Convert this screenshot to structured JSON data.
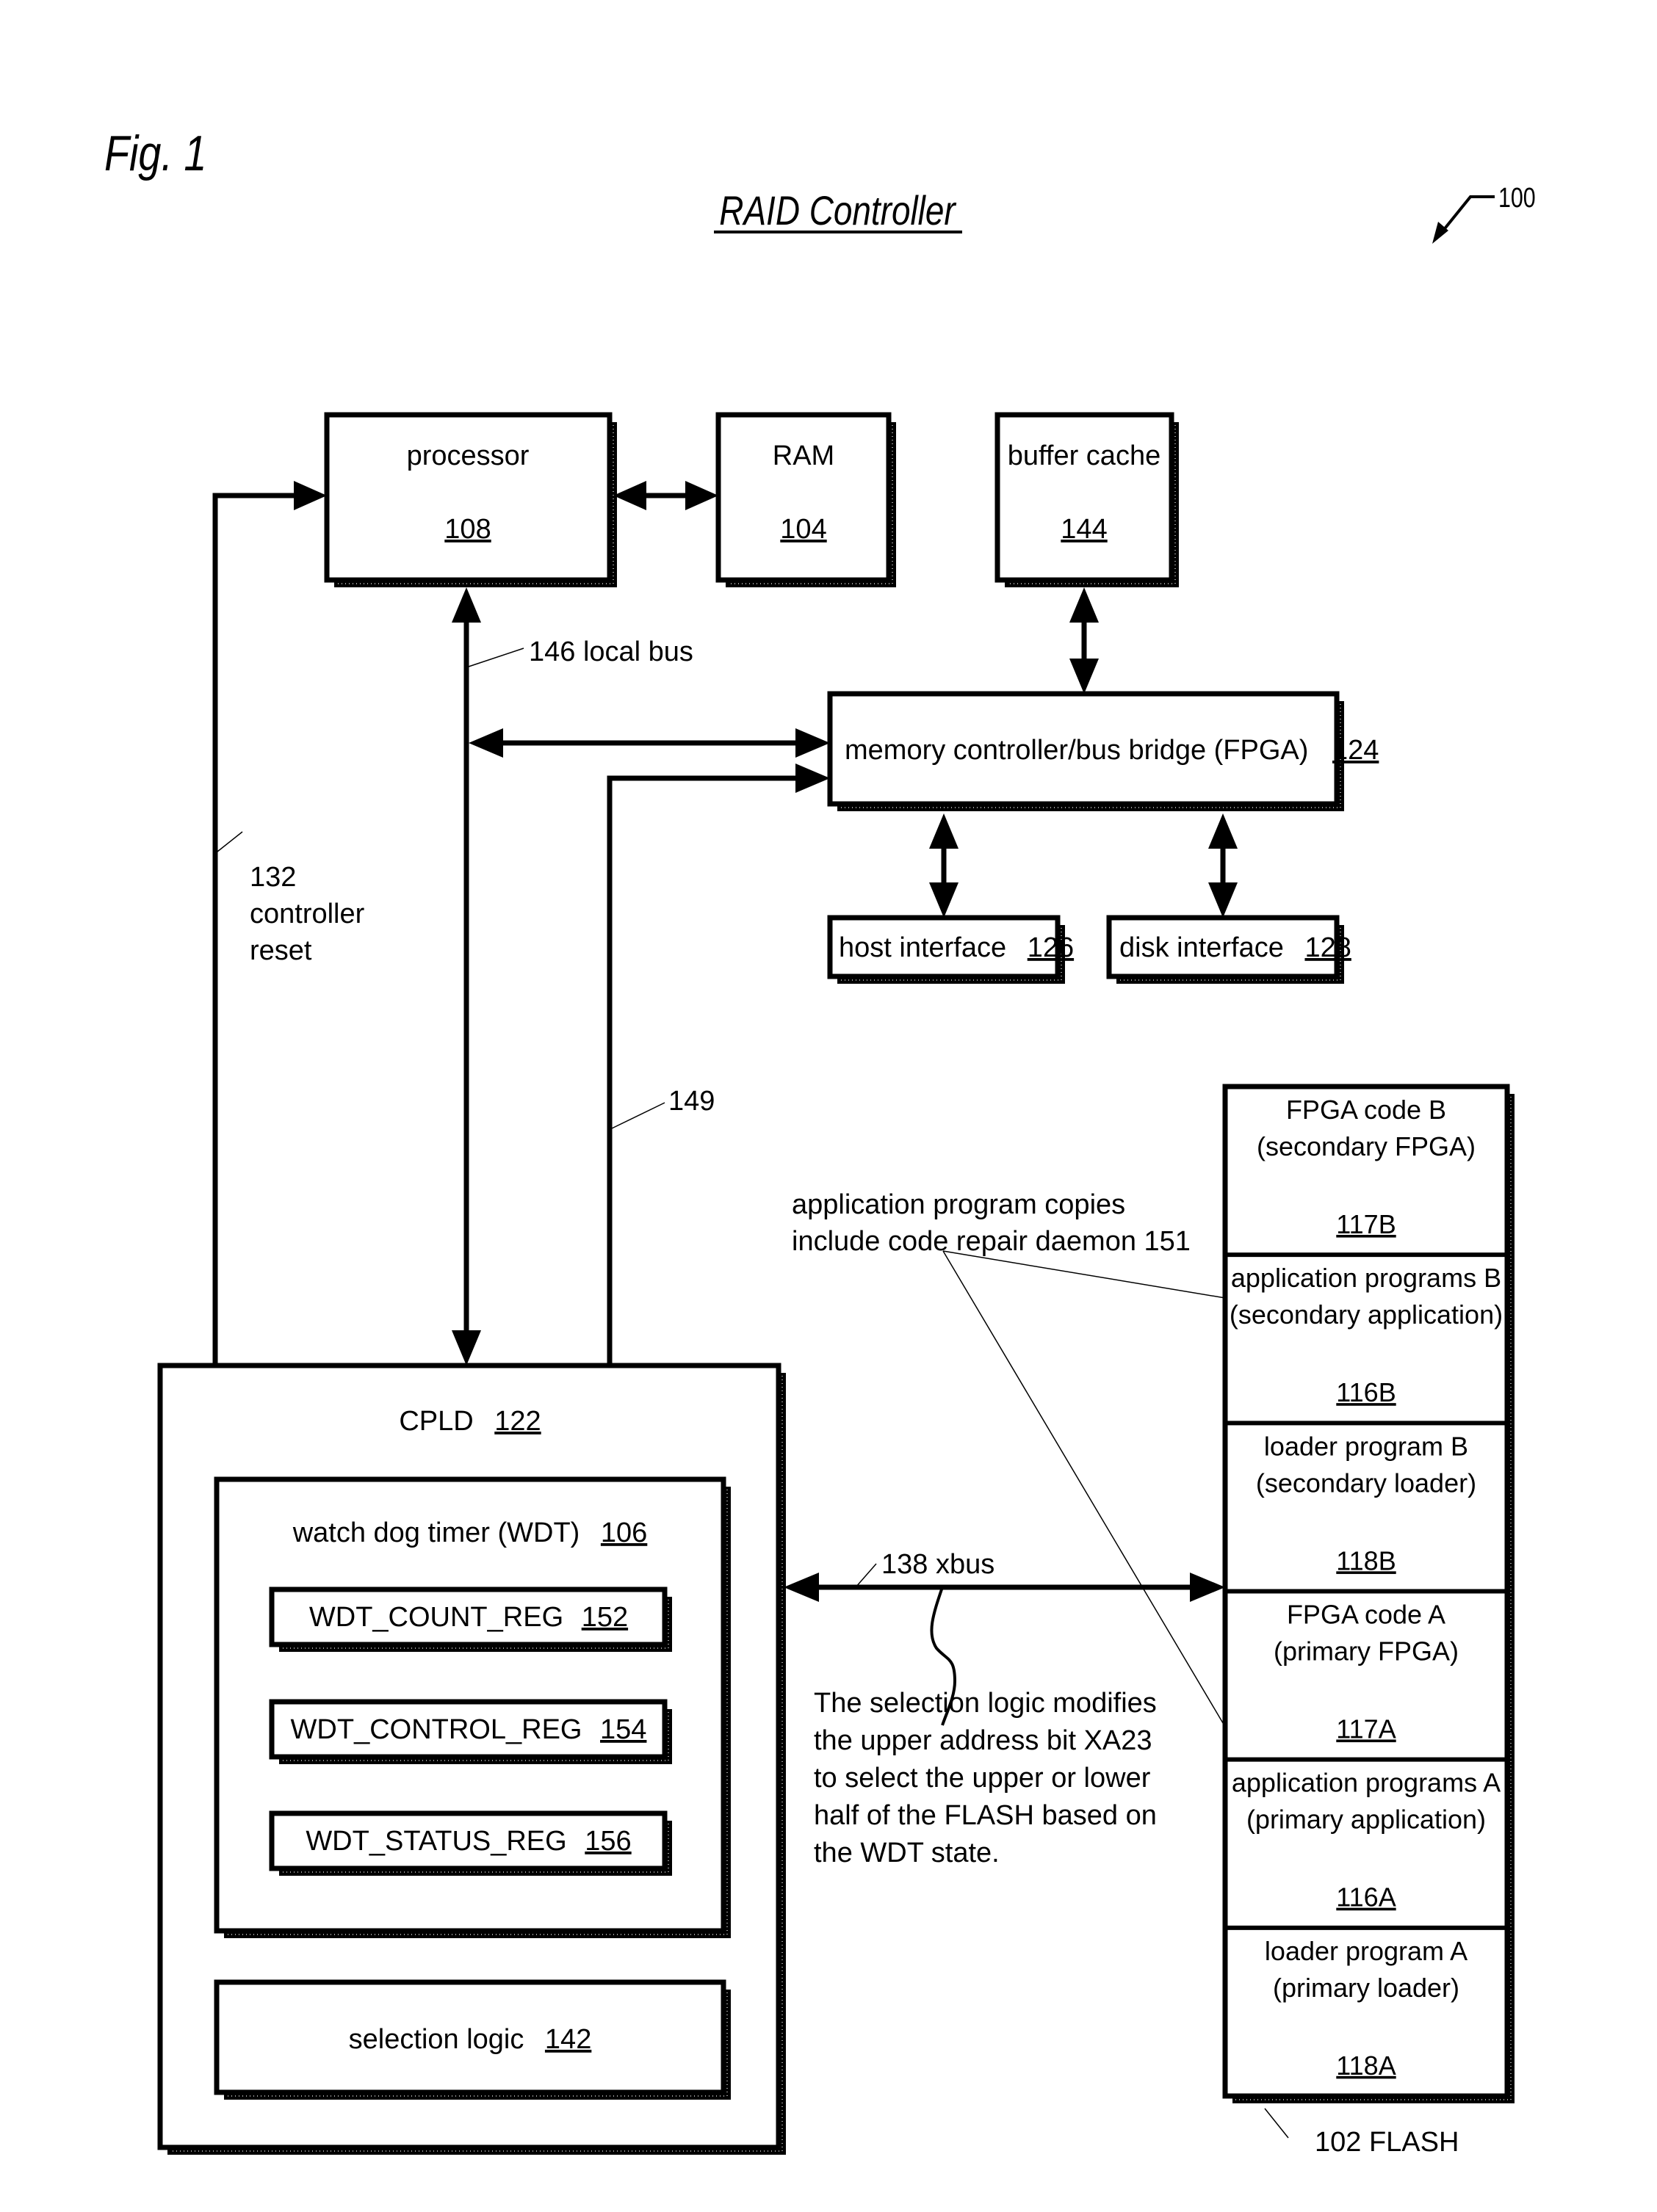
{
  "figure": {
    "fig_label": "Fig. 1",
    "title": "RAID Controller",
    "ref_number": "100"
  },
  "blocks": {
    "processor": {
      "label": "processor",
      "ref": "108"
    },
    "ram": {
      "label": "RAM",
      "ref": "104"
    },
    "buffer_cache": {
      "label": "buffer cache",
      "ref": "144"
    },
    "memory_controller": {
      "label": "memory controller/bus bridge (FPGA)",
      "ref": "124"
    },
    "host_interface": {
      "label": "host interface",
      "ref": "126"
    },
    "disk_interface": {
      "label": "disk interface",
      "ref": "128"
    },
    "cpld": {
      "label": "CPLD",
      "ref": "122"
    },
    "wdt": {
      "label": "watch dog timer (WDT)",
      "ref": "106"
    },
    "registers": [
      {
        "label": "WDT_COUNT_REG",
        "ref": "152"
      },
      {
        "label": "WDT_CONTROL_REG",
        "ref": "154"
      },
      {
        "label": "WDT_STATUS_REG",
        "ref": "156"
      }
    ],
    "selection_logic": {
      "label": "selection logic",
      "ref": "142"
    }
  },
  "flash": {
    "label": "102  FLASH",
    "sections": [
      {
        "line1": "FPGA code B",
        "line2": "(secondary FPGA)",
        "ref": "117B"
      },
      {
        "line1": "application programs B",
        "line2": "(secondary application)",
        "ref": "116B"
      },
      {
        "line1": "loader program B",
        "line2": "(secondary loader)",
        "ref": "118B"
      },
      {
        "line1": "FPGA code A",
        "line2": "(primary FPGA)",
        "ref": "117A"
      },
      {
        "line1": "application programs A",
        "line2": "(primary application)",
        "ref": "116A"
      },
      {
        "line1": "loader program A",
        "line2": "(primary loader)",
        "ref": "118A"
      }
    ]
  },
  "annotations": {
    "local_bus": "146 local bus",
    "controller_reset": [
      "132",
      "controller",
      "reset"
    ],
    "line_149": "149",
    "xbus": "138 xbus",
    "daemon_note": [
      "application program copies",
      "include code repair daemon 151"
    ],
    "selection_note": [
      "The selection logic modifies",
      "the upper address bit XA23",
      "to select the upper or lower",
      "half of the FLASH based on",
      "the WDT state."
    ]
  }
}
